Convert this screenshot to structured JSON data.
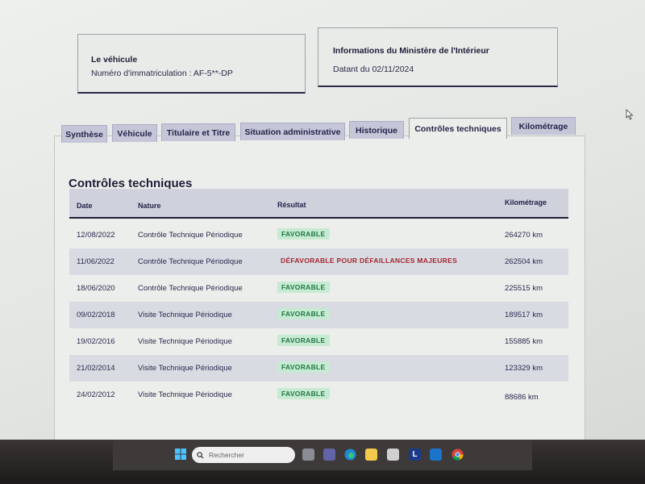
{
  "vehicle_card": {
    "title": "Le véhicule",
    "plate_line": "Numéro d'immatriculation : AF-5**-DP"
  },
  "ministry_card": {
    "title": "Informations du Ministère de l'Intérieur",
    "date_line": "Datant du 02/11/2024"
  },
  "tabs": [
    {
      "label": "Synthèse"
    },
    {
      "label": "Véhicule"
    },
    {
      "label": "Titulaire et Titre"
    },
    {
      "label": "Situation administrative"
    },
    {
      "label": "Historique"
    },
    {
      "label": "Contrôles techniques"
    },
    {
      "label": "Kilométrage"
    }
  ],
  "active_tab": "Contrôles techniques",
  "section": {
    "title": "Contrôles techniques",
    "columns": {
      "date": "Date",
      "nature": "Nature",
      "result": "Résultat",
      "km": "Kilométrage"
    },
    "rows": [
      {
        "date": "12/08/2022",
        "nature": "Contrôle Technique Périodique",
        "result": "FAVORABLE",
        "km": "264270 km"
      },
      {
        "date": "11/06/2022",
        "nature": "Contrôle Technique Périodique",
        "result": "DÉFAVORABLE POUR DÉFAILLANCES MAJEURES",
        "km": "262504 km"
      },
      {
        "date": "18/06/2020",
        "nature": "Contrôle Technique Périodique",
        "result": "FAVORABLE",
        "km": "225515 km"
      },
      {
        "date": "09/02/2018",
        "nature": "Visite Technique Périodique",
        "result": "FAVORABLE",
        "km": "189517 km"
      },
      {
        "date": "19/02/2016",
        "nature": "Visite Technique Périodique",
        "result": "FAVORABLE",
        "km": "155885 km"
      },
      {
        "date": "21/02/2014",
        "nature": "Visite Technique Périodique",
        "result": "FAVORABLE",
        "km": "123329 km"
      },
      {
        "date": "24/02/2012",
        "nature": "Visite Technique Périodique",
        "result": "FAVORABLE",
        "km": "88686 km"
      }
    ]
  },
  "taskbar": {
    "search_placeholder": "Rechercher",
    "icons": [
      "windows-start-icon",
      "task-view-icon",
      "teams-icon",
      "edge-icon",
      "file-explorer-icon",
      "store-icon",
      "l-app-icon",
      "mail-icon",
      "chrome-icon"
    ]
  },
  "colors": {
    "favorable_bg": "#c7ead2",
    "favorable_text": "#1e7a44",
    "defavorable_text": "#a3272f",
    "tab_bg": "#c5c7d8"
  }
}
